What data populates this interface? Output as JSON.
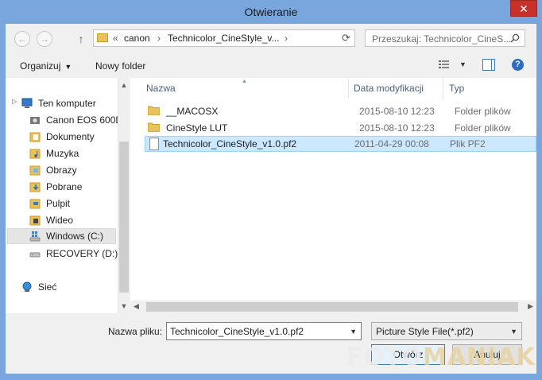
{
  "window": {
    "title": "Otwieranie",
    "close_glyph": "✕"
  },
  "nav_buttons": {
    "back_icon": "←",
    "forward_icon": "→",
    "up_icon": "↑"
  },
  "address": {
    "prefix": "«",
    "segments": [
      "canon",
      "Technicolor_CineStyle_v..."
    ],
    "separator": "›",
    "refresh_icon": "⟳"
  },
  "search": {
    "placeholder": "Przeszukaj: Technicolor_CineS..."
  },
  "toolbar": {
    "organize_label": "Organizuj",
    "new_folder_label": "Nowy folder",
    "help_label": "?"
  },
  "sidebar": {
    "items": [
      {
        "label": "Ten komputer",
        "icon": "computer-icon"
      },
      {
        "label": "Canon EOS 600D",
        "icon": "camera-icon"
      },
      {
        "label": "Dokumenty",
        "icon": "documents-icon"
      },
      {
        "label": "Muzyka",
        "icon": "music-icon"
      },
      {
        "label": "Obrazy",
        "icon": "pictures-icon"
      },
      {
        "label": "Pobrane",
        "icon": "downloads-icon"
      },
      {
        "label": "Pulpit",
        "icon": "desktop-icon"
      },
      {
        "label": "Wideo",
        "icon": "videos-icon"
      },
      {
        "label": "Windows (C:)",
        "icon": "drive-icon"
      },
      {
        "label": "RECOVERY (D:)",
        "icon": "drive-icon"
      },
      {
        "label": "Sieć",
        "icon": "network-icon"
      }
    ]
  },
  "file_list": {
    "columns": [
      "Nazwa",
      "Data modyfikacji",
      "Typ"
    ],
    "rows": [
      {
        "name": "__MACOSX",
        "date": "2015-08-10 12:23",
        "type": "Folder plików",
        "kind": "folder"
      },
      {
        "name": "CineStyle LUT",
        "date": "2015-08-10 12:23",
        "type": "Folder plików",
        "kind": "folder"
      },
      {
        "name": "Technicolor_CineStyle_v1.0.pf2",
        "date": "2011-04-29 00:08",
        "type": "Plik PF2",
        "kind": "file"
      }
    ]
  },
  "bottom": {
    "filename_label": "Nazwa pliku:",
    "filename_value": "Technicolor_CineStyle_v1.0.pf2",
    "filetype_value": "Picture Style File(*.pf2)",
    "open_label": "Otwórz",
    "cancel_label": "Anuluj"
  },
  "watermark": {
    "part1": "FOTO",
    "part2": "MANIAK"
  },
  "colors": {
    "selection": "#cce8ff",
    "titlebar": "#7aa6de",
    "close": "#c7312a"
  }
}
